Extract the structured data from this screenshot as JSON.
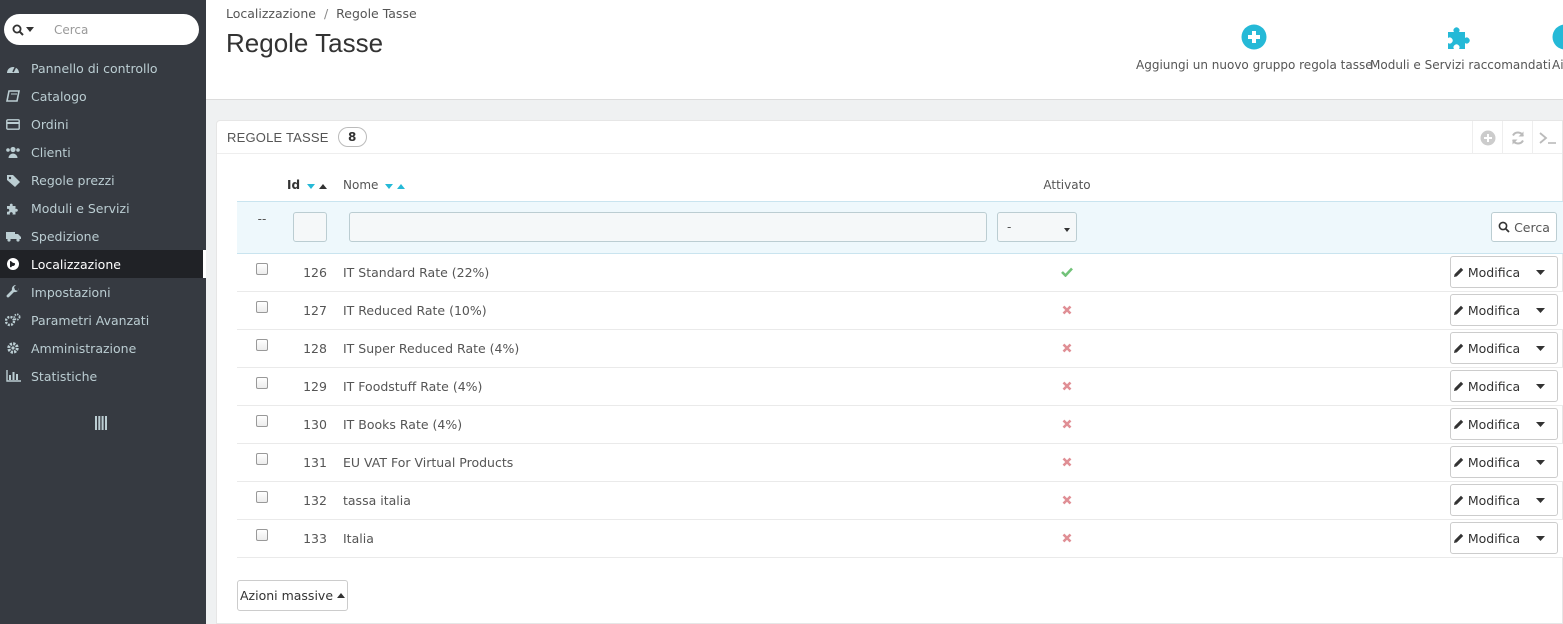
{
  "sidebar": {
    "search_placeholder": "Cerca",
    "items": [
      {
        "label": "Pannello di controllo",
        "icon": "dashboard-icon"
      },
      {
        "label": "Catalogo",
        "icon": "book-icon"
      },
      {
        "label": "Ordini",
        "icon": "credit-card-icon"
      },
      {
        "label": "Clienti",
        "icon": "users-icon"
      },
      {
        "label": "Regole prezzi",
        "icon": "tags-icon"
      },
      {
        "label": "Moduli e Servizi",
        "icon": "puzzle-icon"
      },
      {
        "label": "Spedizione",
        "icon": "truck-icon"
      },
      {
        "label": "Localizzazione",
        "icon": "globe-icon",
        "active": true
      },
      {
        "label": "Impostazioni",
        "icon": "wrench-icon"
      },
      {
        "label": "Parametri Avanzati",
        "icon": "cogs-icon"
      },
      {
        "label": "Amministrazione",
        "icon": "cog-icon"
      },
      {
        "label": "Statistiche",
        "icon": "bar-chart-icon"
      }
    ]
  },
  "header": {
    "breadcrumb": [
      "Localizzazione",
      "Regole Tasse"
    ],
    "breadcrumb_sep": "/",
    "title": "Regole Tasse",
    "toolbar": {
      "add_label": "Aggiungi un nuovo gruppo regola tasse",
      "modules_label": "Moduli e Servizi raccomandati",
      "help_label": "Ai"
    }
  },
  "panel": {
    "title": "REGOLE TASSE",
    "count": "8",
    "columns": {
      "id": "Id",
      "name": "Nome",
      "active": "Attivato"
    },
    "filter": {
      "select_value": "-",
      "search_label": "Cerca",
      "placeholder_dash": "--"
    },
    "rows": [
      {
        "id": "126",
        "name": "IT Standard Rate (22%)",
        "active": true
      },
      {
        "id": "127",
        "name": "IT Reduced Rate (10%)",
        "active": false
      },
      {
        "id": "128",
        "name": "IT Super Reduced Rate (4%)",
        "active": false
      },
      {
        "id": "129",
        "name": "IT Foodstuff Rate (4%)",
        "active": false
      },
      {
        "id": "130",
        "name": "IT Books Rate (4%)",
        "active": false
      },
      {
        "id": "131",
        "name": "EU VAT For Virtual Products",
        "active": false
      },
      {
        "id": "132",
        "name": "tassa italia",
        "active": false
      },
      {
        "id": "133",
        "name": "Italia",
        "active": false
      }
    ],
    "edit_label": "Modifica",
    "bulk_label": "Azioni massive"
  },
  "colors": {
    "sidebar_bg": "#363a41",
    "accent": "#25b9d7",
    "check": "#72c279",
    "cross": "#e08f95"
  }
}
